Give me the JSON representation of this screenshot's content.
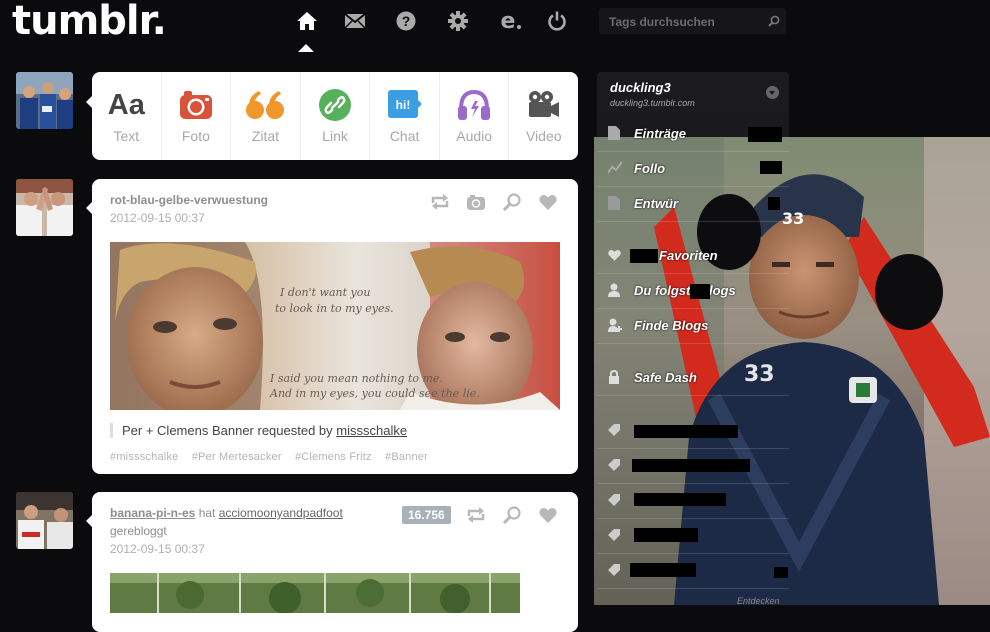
{
  "header": {
    "logo": "tumblr.",
    "nav_icons": [
      "home-icon",
      "mail-icon",
      "help-icon",
      "gear-icon",
      "edit-e-icon",
      "power-icon"
    ],
    "search_placeholder": "Tags durchsuchen"
  },
  "postbar": {
    "items": [
      {
        "label": "Text",
        "icon": "text-icon",
        "glyph": "Aa"
      },
      {
        "label": "Foto",
        "icon": "camera-icon"
      },
      {
        "label": "Zitat",
        "icon": "quote-icon",
        "glyph": "“"
      },
      {
        "label": "Link",
        "icon": "link-icon"
      },
      {
        "label": "Chat",
        "icon": "chat-icon",
        "glyph": "hi!"
      },
      {
        "label": "Audio",
        "icon": "headphones-icon"
      },
      {
        "label": "Video",
        "icon": "video-camera-icon"
      }
    ]
  },
  "posts": [
    {
      "username": "rot-blau-gelbe-verwuestung",
      "timestamp": "2012-09-15 00:37",
      "image_quote_1": "I don't want you to look in to my eyes.",
      "image_quote_2": "I said you mean nothing to me. And in my eyes, you could see the lie.",
      "caption_prefix": "Per + Clemens Banner requested by ",
      "caption_link": "missschalke",
      "tags": [
        "#missschalke",
        "#Per Mertesacker",
        "#Clemens Fritz",
        "#Banner"
      ]
    },
    {
      "username": "banana-pi-n-es",
      "reblog_word": "hat",
      "reblog_source": "acciomoonyandpadfoot",
      "reblog_suffix": "gerebloggt",
      "timestamp": "2012-09-15 00:37",
      "notes": "16.756"
    }
  ],
  "sidebar": {
    "blog_name": "duckling3",
    "blog_url": "duckling3.tumblr.com",
    "items": [
      {
        "label": "Einträge",
        "icon": "document-icon"
      },
      {
        "label": "Follo",
        "icon": "chart-icon"
      },
      {
        "label": "Entwür",
        "icon": "draft-icon"
      },
      {
        "label": "Favoriten",
        "icon": "heart-icon"
      },
      {
        "label": "Du folgst",
        "label_2": "logs",
        "icon": "person-icon"
      },
      {
        "label": "Finde Blogs",
        "icon": "person-add-icon"
      },
      {
        "label": "Safe Dash",
        "icon": "lock-icon"
      }
    ],
    "footer": "Entdecken"
  }
}
